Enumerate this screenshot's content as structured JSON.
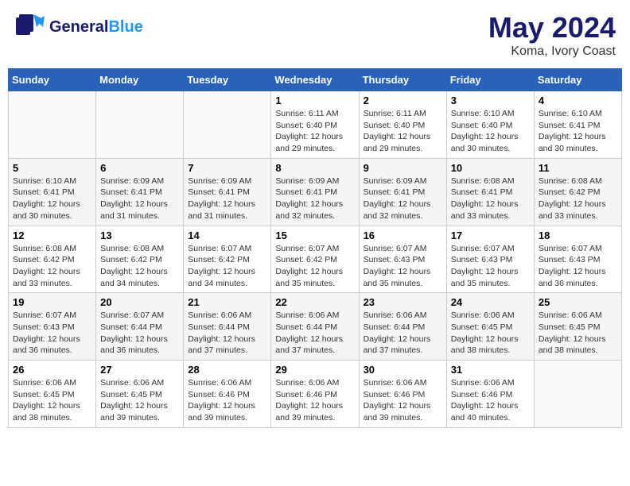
{
  "header": {
    "logo_general": "General",
    "logo_blue": "Blue",
    "main_title": "May 2024",
    "subtitle": "Koma, Ivory Coast"
  },
  "weekdays": [
    "Sunday",
    "Monday",
    "Tuesday",
    "Wednesday",
    "Thursday",
    "Friday",
    "Saturday"
  ],
  "weeks": [
    [
      {
        "day": "",
        "info": ""
      },
      {
        "day": "",
        "info": ""
      },
      {
        "day": "",
        "info": ""
      },
      {
        "day": "1",
        "info": "Sunrise: 6:11 AM\nSunset: 6:40 PM\nDaylight: 12 hours and 29 minutes."
      },
      {
        "day": "2",
        "info": "Sunrise: 6:11 AM\nSunset: 6:40 PM\nDaylight: 12 hours and 29 minutes."
      },
      {
        "day": "3",
        "info": "Sunrise: 6:10 AM\nSunset: 6:40 PM\nDaylight: 12 hours and 30 minutes."
      },
      {
        "day": "4",
        "info": "Sunrise: 6:10 AM\nSunset: 6:41 PM\nDaylight: 12 hours and 30 minutes."
      }
    ],
    [
      {
        "day": "5",
        "info": "Sunrise: 6:10 AM\nSunset: 6:41 PM\nDaylight: 12 hours and 30 minutes."
      },
      {
        "day": "6",
        "info": "Sunrise: 6:09 AM\nSunset: 6:41 PM\nDaylight: 12 hours and 31 minutes."
      },
      {
        "day": "7",
        "info": "Sunrise: 6:09 AM\nSunset: 6:41 PM\nDaylight: 12 hours and 31 minutes."
      },
      {
        "day": "8",
        "info": "Sunrise: 6:09 AM\nSunset: 6:41 PM\nDaylight: 12 hours and 32 minutes."
      },
      {
        "day": "9",
        "info": "Sunrise: 6:09 AM\nSunset: 6:41 PM\nDaylight: 12 hours and 32 minutes."
      },
      {
        "day": "10",
        "info": "Sunrise: 6:08 AM\nSunset: 6:41 PM\nDaylight: 12 hours and 33 minutes."
      },
      {
        "day": "11",
        "info": "Sunrise: 6:08 AM\nSunset: 6:42 PM\nDaylight: 12 hours and 33 minutes."
      }
    ],
    [
      {
        "day": "12",
        "info": "Sunrise: 6:08 AM\nSunset: 6:42 PM\nDaylight: 12 hours and 33 minutes."
      },
      {
        "day": "13",
        "info": "Sunrise: 6:08 AM\nSunset: 6:42 PM\nDaylight: 12 hours and 34 minutes."
      },
      {
        "day": "14",
        "info": "Sunrise: 6:07 AM\nSunset: 6:42 PM\nDaylight: 12 hours and 34 minutes."
      },
      {
        "day": "15",
        "info": "Sunrise: 6:07 AM\nSunset: 6:42 PM\nDaylight: 12 hours and 35 minutes."
      },
      {
        "day": "16",
        "info": "Sunrise: 6:07 AM\nSunset: 6:43 PM\nDaylight: 12 hours and 35 minutes."
      },
      {
        "day": "17",
        "info": "Sunrise: 6:07 AM\nSunset: 6:43 PM\nDaylight: 12 hours and 35 minutes."
      },
      {
        "day": "18",
        "info": "Sunrise: 6:07 AM\nSunset: 6:43 PM\nDaylight: 12 hours and 36 minutes."
      }
    ],
    [
      {
        "day": "19",
        "info": "Sunrise: 6:07 AM\nSunset: 6:43 PM\nDaylight: 12 hours and 36 minutes."
      },
      {
        "day": "20",
        "info": "Sunrise: 6:07 AM\nSunset: 6:44 PM\nDaylight: 12 hours and 36 minutes."
      },
      {
        "day": "21",
        "info": "Sunrise: 6:06 AM\nSunset: 6:44 PM\nDaylight: 12 hours and 37 minutes."
      },
      {
        "day": "22",
        "info": "Sunrise: 6:06 AM\nSunset: 6:44 PM\nDaylight: 12 hours and 37 minutes."
      },
      {
        "day": "23",
        "info": "Sunrise: 6:06 AM\nSunset: 6:44 PM\nDaylight: 12 hours and 37 minutes."
      },
      {
        "day": "24",
        "info": "Sunrise: 6:06 AM\nSunset: 6:45 PM\nDaylight: 12 hours and 38 minutes."
      },
      {
        "day": "25",
        "info": "Sunrise: 6:06 AM\nSunset: 6:45 PM\nDaylight: 12 hours and 38 minutes."
      }
    ],
    [
      {
        "day": "26",
        "info": "Sunrise: 6:06 AM\nSunset: 6:45 PM\nDaylight: 12 hours and 38 minutes."
      },
      {
        "day": "27",
        "info": "Sunrise: 6:06 AM\nSunset: 6:45 PM\nDaylight: 12 hours and 39 minutes."
      },
      {
        "day": "28",
        "info": "Sunrise: 6:06 AM\nSunset: 6:46 PM\nDaylight: 12 hours and 39 minutes."
      },
      {
        "day": "29",
        "info": "Sunrise: 6:06 AM\nSunset: 6:46 PM\nDaylight: 12 hours and 39 minutes."
      },
      {
        "day": "30",
        "info": "Sunrise: 6:06 AM\nSunset: 6:46 PM\nDaylight: 12 hours and 39 minutes."
      },
      {
        "day": "31",
        "info": "Sunrise: 6:06 AM\nSunset: 6:46 PM\nDaylight: 12 hours and 40 minutes."
      },
      {
        "day": "",
        "info": ""
      }
    ]
  ]
}
